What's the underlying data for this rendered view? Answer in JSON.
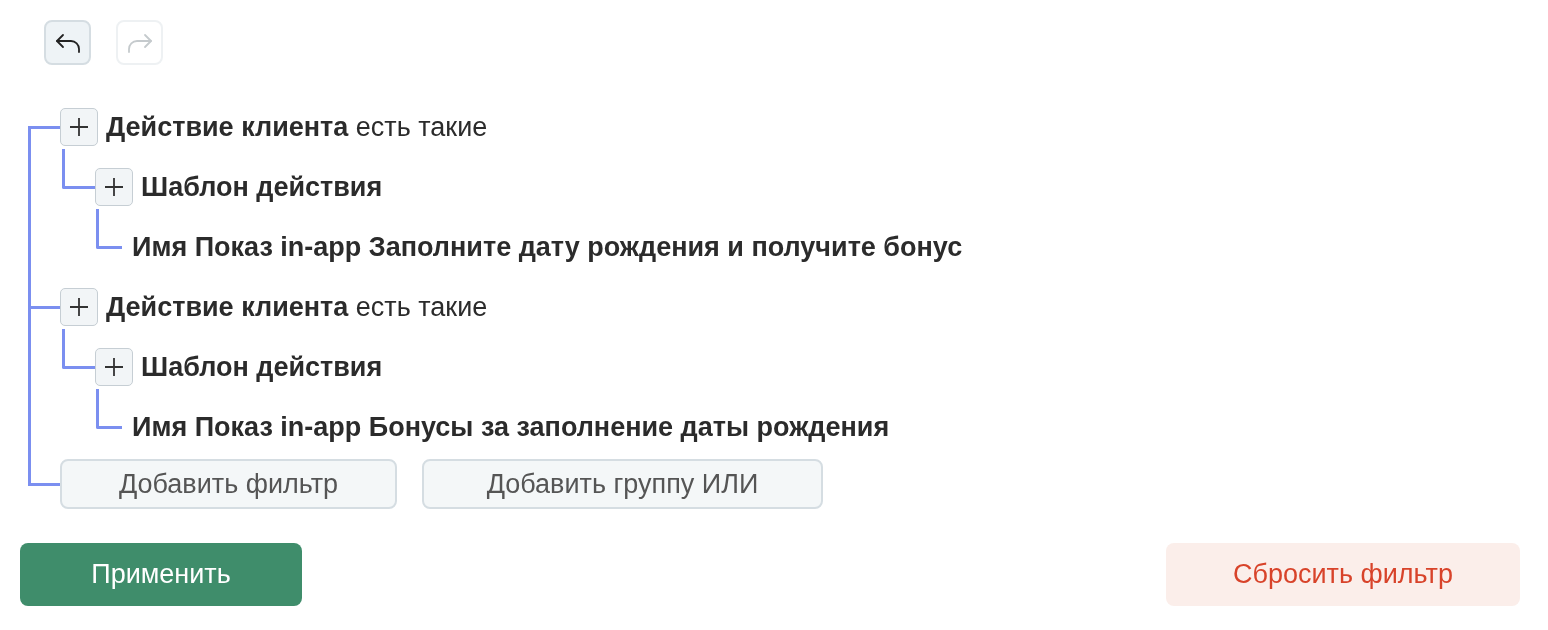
{
  "history": {
    "undo": {
      "disabled": false
    },
    "redo": {
      "disabled": true
    }
  },
  "filters": [
    {
      "name": "Действие клиента",
      "value": "есть такие",
      "addable": true,
      "children": [
        {
          "name": "Шаблон действия",
          "addable": true,
          "children": [
            {
              "name": "Имя Показ in-app Заполните дату рождения и получите бонус",
              "addable": false
            }
          ]
        }
      ]
    },
    {
      "name": "Действие клиента",
      "value": "есть такие",
      "addable": true,
      "children": [
        {
          "name": "Шаблон действия",
          "addable": true,
          "children": [
            {
              "name": "Имя Показ in-app Бонусы за заполнение даты рождения",
              "addable": false
            }
          ]
        }
      ]
    }
  ],
  "tree_buttons": [
    {
      "label": "Добавить фильтр"
    },
    {
      "label": "Добавить группу ИЛИ"
    }
  ],
  "footer": {
    "apply": "Применить",
    "reset": "Сбросить фильтр"
  }
}
